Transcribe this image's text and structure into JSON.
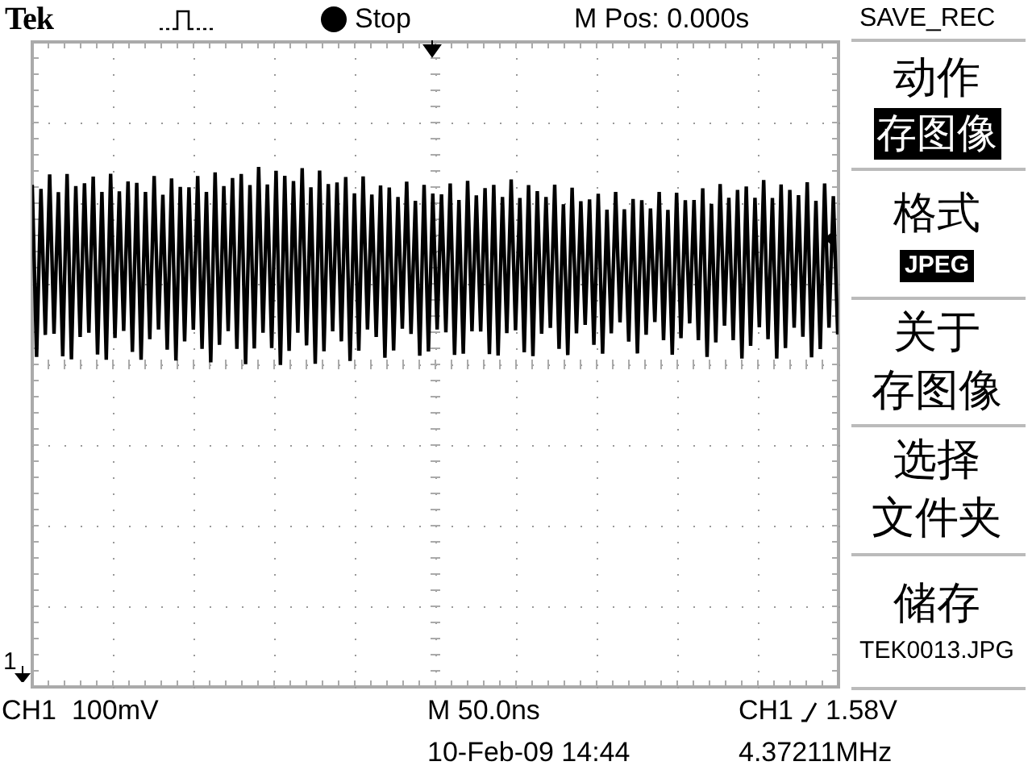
{
  "header": {
    "brand": "Tek",
    "trigger_status": "Stop",
    "m_pos": "M Pos: 0.000s"
  },
  "menu": {
    "title": "SAVE_REC",
    "items": [
      {
        "kind": "option",
        "label": [
          "动作"
        ],
        "value": "存图像"
      },
      {
        "kind": "option",
        "label": [
          "格式"
        ],
        "value": "JPEG"
      },
      {
        "kind": "action",
        "label": [
          "关于",
          "存图像"
        ]
      },
      {
        "kind": "action",
        "label": [
          "选择",
          "文件夹"
        ]
      },
      {
        "kind": "action",
        "label": [
          "储存"
        ],
        "value": "TEK0013.JPG"
      }
    ]
  },
  "channel_marker": "1",
  "footer": {
    "ch_scale": "CH1  100mV",
    "timebase": "M 50.0ns",
    "trigger_source": "CH1",
    "trigger_level": "1.58V",
    "date": "10-Feb-09 14:44",
    "frequency": "4.37211MHz"
  }
}
